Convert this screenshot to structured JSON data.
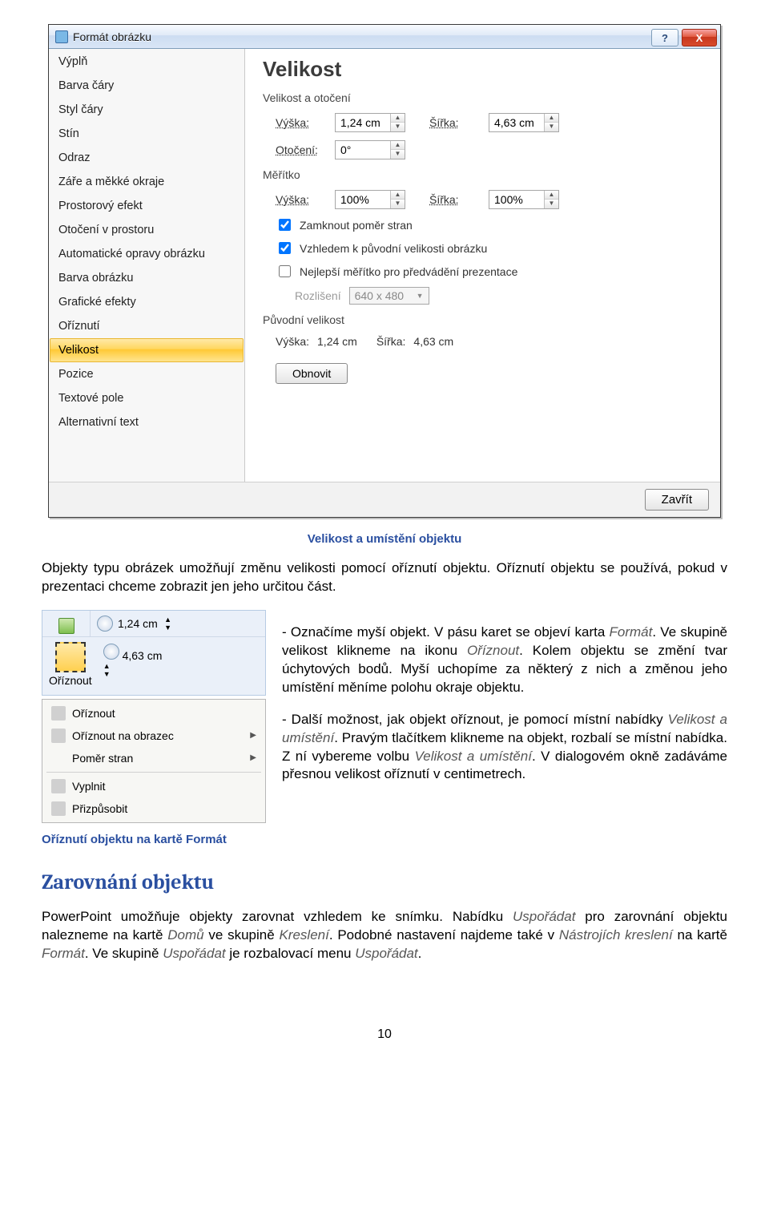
{
  "dialog": {
    "title": "Formát obrázku",
    "help": "?",
    "close": "X",
    "nav": [
      "Výplň",
      "Barva čáry",
      "Styl čáry",
      "Stín",
      "Odraz",
      "Záře a měkké okraje",
      "Prostorový efekt",
      "Otočení v prostoru",
      "Automatické opravy obrázku",
      "Barva obrázku",
      "Grafické efekty",
      "Oříznutí",
      "Velikost",
      "Pozice",
      "Textové pole",
      "Alternativní text"
    ],
    "nav_selected_index": 12,
    "panel": {
      "heading": "Velikost",
      "group_size": "Velikost a otočení",
      "height_label": "Výška:",
      "height_value": "1,24 cm",
      "width_label": "Šířka:",
      "width_value": "4,63 cm",
      "rotation_label": "Otočení:",
      "rotation_value": "0°",
      "group_scale": "Měřítko",
      "scale_h_label": "Výška:",
      "scale_h_value": "100%",
      "scale_w_label": "Šířka:",
      "scale_w_value": "100%",
      "lock_aspect": "Zamknout poměr stran",
      "rel_original": "Vzhledem k původní velikosti obrázku",
      "best_scale": "Nejlepší měřítko pro předvádění prezentace",
      "resolution_label": "Rozlišení",
      "resolution_value": "640 x 480",
      "group_original": "Původní velikost",
      "orig_h_label": "Výška:",
      "orig_h_value": "1,24 cm",
      "orig_w_label": "Šířka:",
      "orig_w_value": "4,63 cm",
      "reset": "Obnovit",
      "close_btn": "Zavřít"
    }
  },
  "caption1": "Velikost a umístění objektu",
  "para1": "Objekty typu obrázek umožňují změnu velikosti pomocí oříznutí objektu. Oříznutí objektu se používá, pokud v prezentaci chceme zobrazit jen jeho určitou část.",
  "ribbon": {
    "dim1": "1,24 cm",
    "crop_label": "Oříznout",
    "dim2": "4,63 cm",
    "menu": [
      "Oříznout",
      "Oříznout na obrazec",
      "Poměr stran",
      "Vyplnit",
      "Přizpůsobit"
    ]
  },
  "para2_a": "-  Označíme myší objekt. V pásu karet se objeví karta ",
  "para2_b": "Formát",
  "para2_c": ". Ve skupině velikost klikneme na ikonu ",
  "para2_d": "Oříznout",
  "para2_e": ". Kolem objektu se změní tvar úchytových bodů. Myší uchopíme za některý z nich a změnou jeho umístění měníme polohu okraje objektu.",
  "para3_a": "-  Další možnost, jak objekt oříznout, je pomocí místní nabídky ",
  "para3_b": "Velikost a umístění",
  "para3_c": ". Pravým tlačítkem klikneme na objekt, rozbalí se místní nabídka. Z ní vybereme volbu ",
  "para3_d": "Velikost a umístění",
  "para3_e": ". V dialogovém okně zadáváme přesnou velikost oříznutí v centimetrech.",
  "caption2": "Oříznutí objektu na kartě Formát",
  "heading2": "Zarovnání objektu",
  "para4_a": "PowerPoint umožňuje objekty zarovnat vzhledem ke snímku. Nabídku ",
  "para4_b": "Uspořádat",
  "para4_c": " pro zarovnání objektu nalezneme na kartě ",
  "para4_d": "Domů",
  "para4_e": " ve skupině ",
  "para4_f": "Kreslení",
  "para4_g": ". Podobné nastavení najdeme také v ",
  "para4_h": "Nástrojích kreslení",
  "para4_i": " na kartě ",
  "para4_j": "Formát",
  "para4_k": ". Ve skupině ",
  "para4_l": "Uspořádat",
  "para4_m": " je rozbalovací menu ",
  "para4_n": "Uspořádat",
  "para4_o": ".",
  "page_number": "10"
}
